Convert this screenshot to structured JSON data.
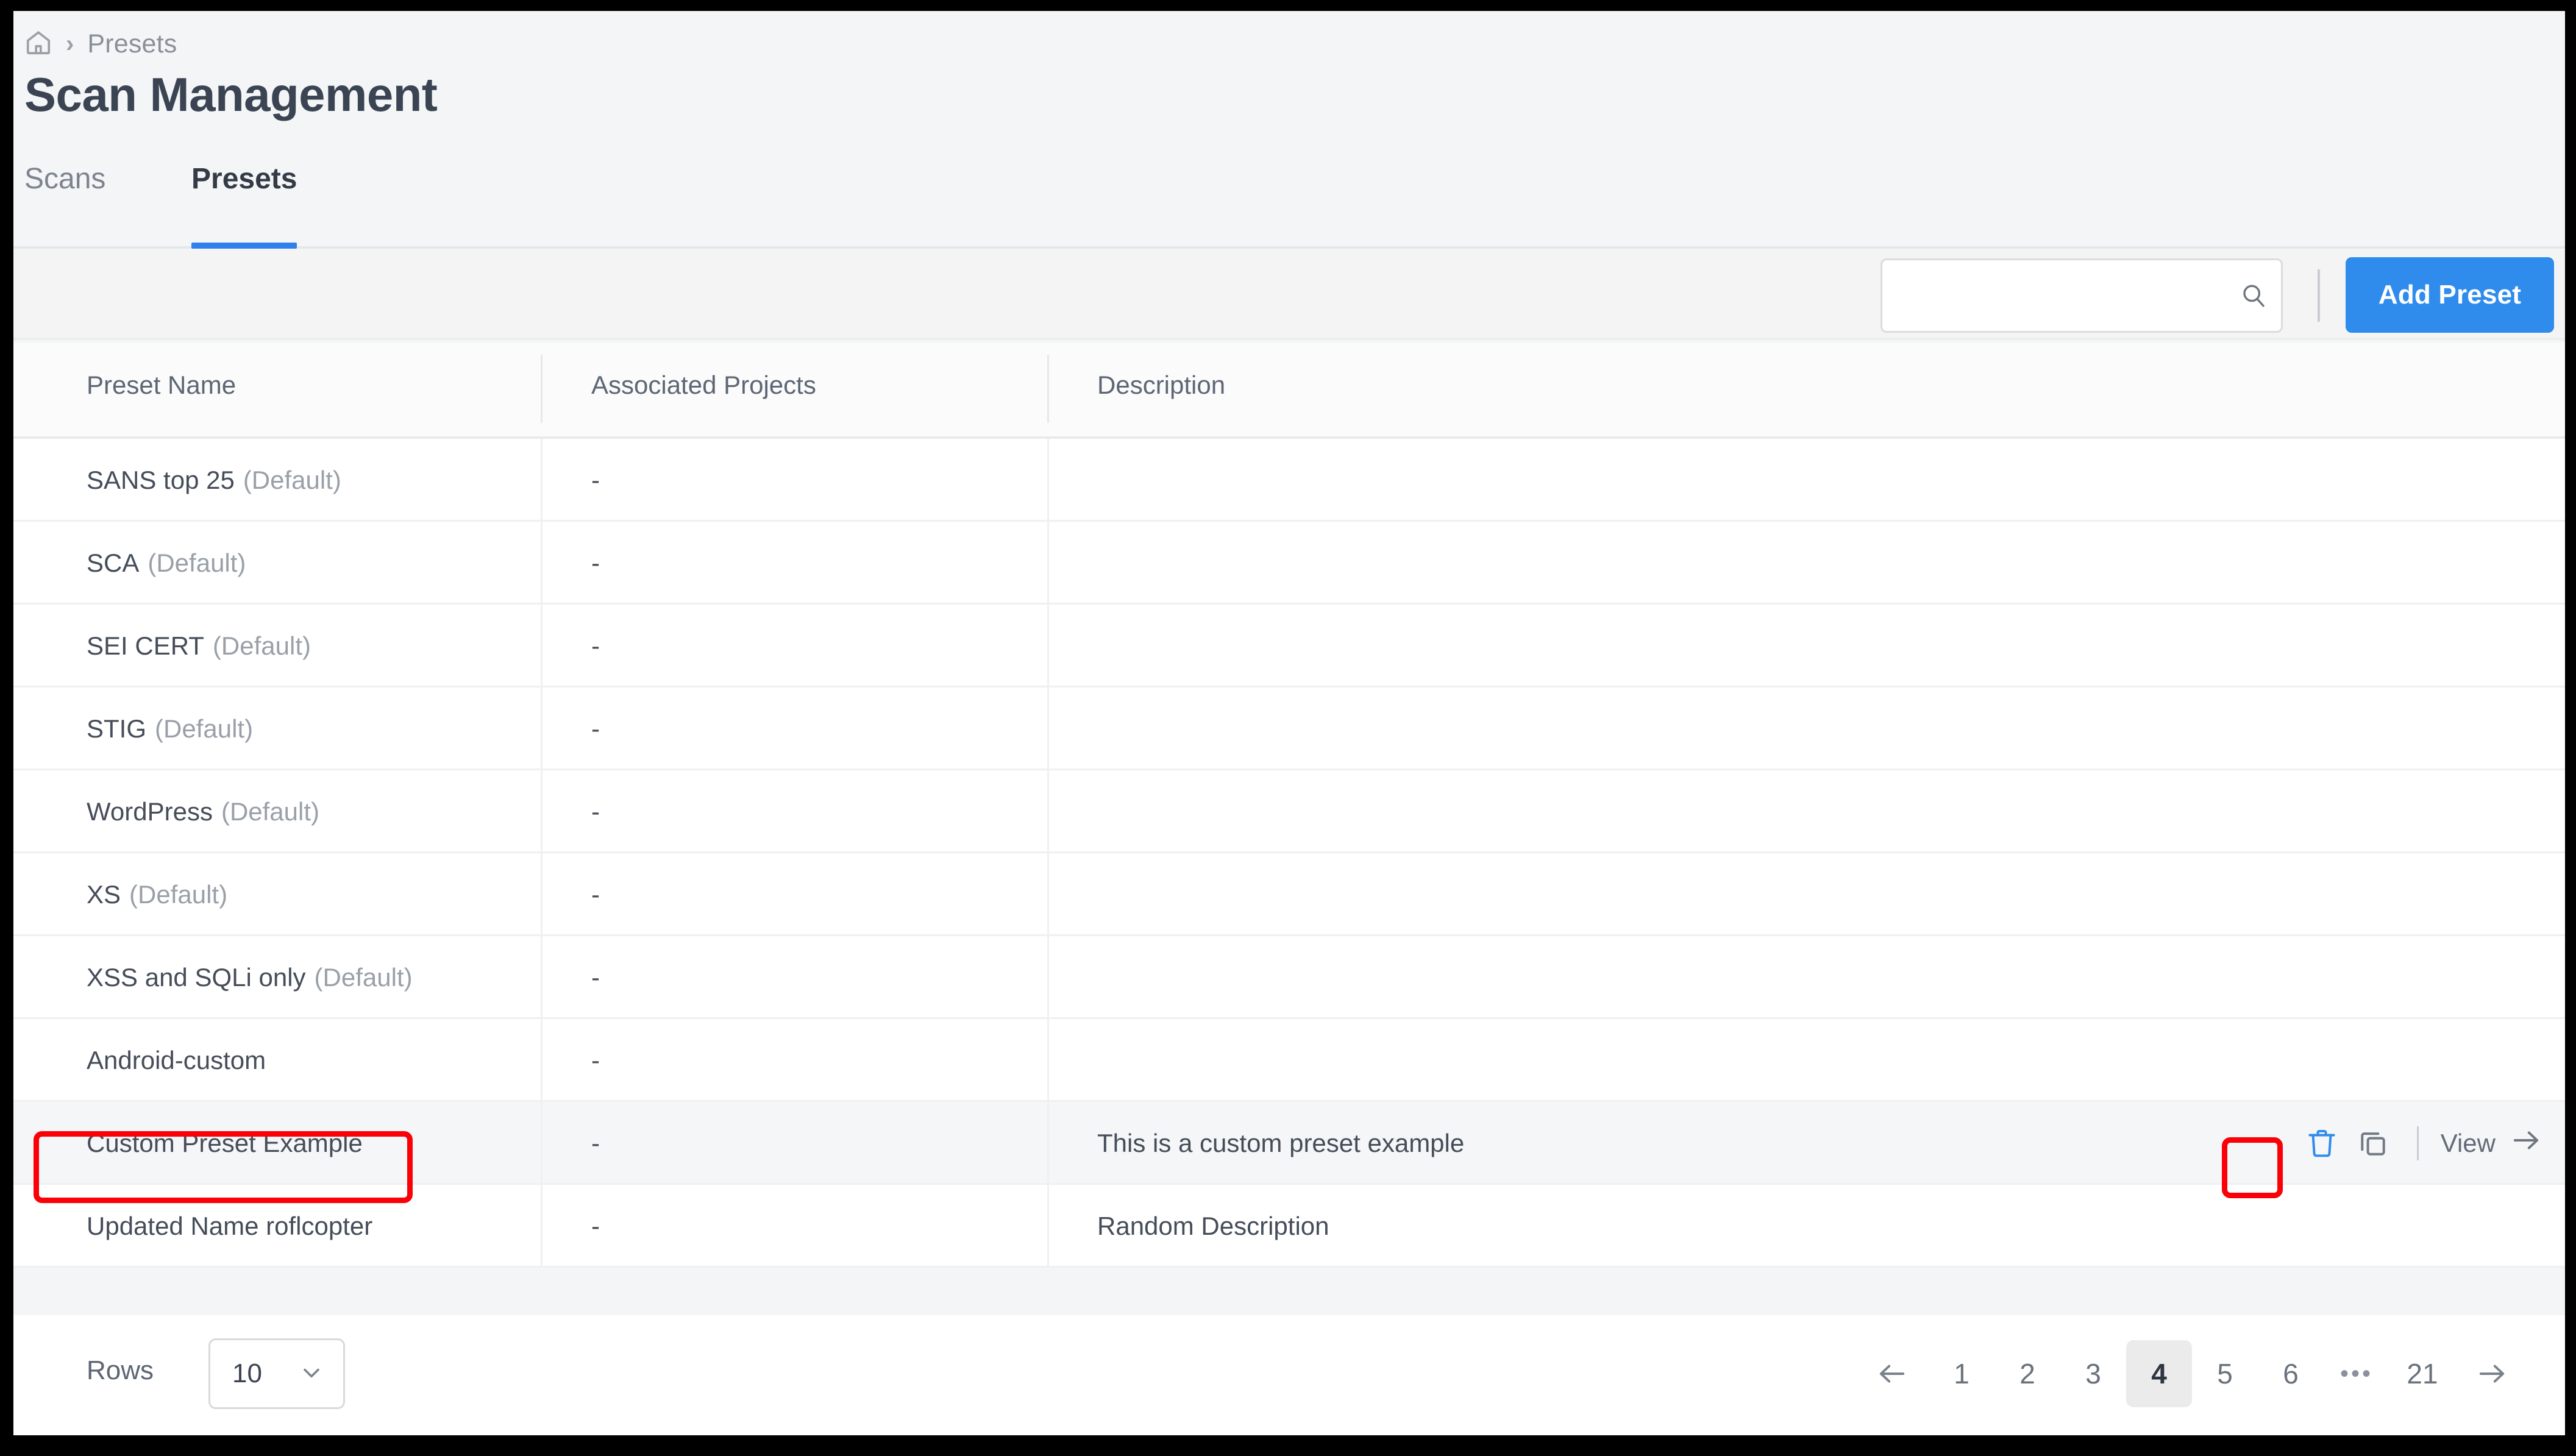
{
  "breadcrumb": {
    "home_icon": "home-icon",
    "separator": "›",
    "current": "Presets"
  },
  "page_title": "Scan Management",
  "tabs": [
    {
      "label": "Scans",
      "active": false
    },
    {
      "label": "Presets",
      "active": true
    }
  ],
  "toolbar": {
    "search": {
      "value": "",
      "placeholder": "",
      "icon": "search-icon"
    },
    "add_preset_label": "Add Preset",
    "accent_color": "#2f8ced"
  },
  "table": {
    "columns": [
      "Preset Name",
      "Associated Projects",
      "Description"
    ],
    "rows": [
      {
        "name": "SANS top 25",
        "tag": "(Default)",
        "projects": "-",
        "description": "",
        "hovered": false
      },
      {
        "name": "SCA",
        "tag": "(Default)",
        "projects": "-",
        "description": "",
        "hovered": false
      },
      {
        "name": "SEI CERT",
        "tag": "(Default)",
        "projects": "-",
        "description": "",
        "hovered": false
      },
      {
        "name": "STIG",
        "tag": "(Default)",
        "projects": "-",
        "description": "",
        "hovered": false
      },
      {
        "name": "WordPress",
        "tag": "(Default)",
        "projects": "-",
        "description": "",
        "hovered": false
      },
      {
        "name": "XS",
        "tag": "(Default)",
        "projects": "-",
        "description": "",
        "hovered": false
      },
      {
        "name": "XSS and SQLi only",
        "tag": "(Default)",
        "projects": "-",
        "description": "",
        "hovered": false
      },
      {
        "name": "Android-custom",
        "tag": "",
        "projects": "-",
        "description": "",
        "hovered": false
      },
      {
        "name": "Custom Preset Example",
        "tag": "",
        "projects": "-",
        "description": "This is a custom preset example",
        "hovered": true
      },
      {
        "name": "Updated Name roflcopter",
        "tag": "",
        "projects": "-",
        "description": "Random Description",
        "hovered": false
      }
    ],
    "row_actions": {
      "delete_icon": "trash-icon",
      "duplicate_icon": "copy-icon",
      "view_label": "View",
      "view_arrow_icon": "arrow-right-icon",
      "delete_icon_color": "#2f8ced"
    }
  },
  "footer": {
    "rows_label": "Rows",
    "rows_per_page": "10",
    "rows_chevron_icon": "chevron-down-icon",
    "pagination": {
      "prev_icon": "arrow-left-icon",
      "next_icon": "arrow-right-icon",
      "pages": [
        "1",
        "2",
        "3",
        "4",
        "5",
        "6",
        "•••",
        "21"
      ],
      "current": "4"
    }
  },
  "annotations": {
    "highlight_color": "#fb0007",
    "boxes": [
      "preset-name-cell",
      "delete-icon"
    ]
  }
}
